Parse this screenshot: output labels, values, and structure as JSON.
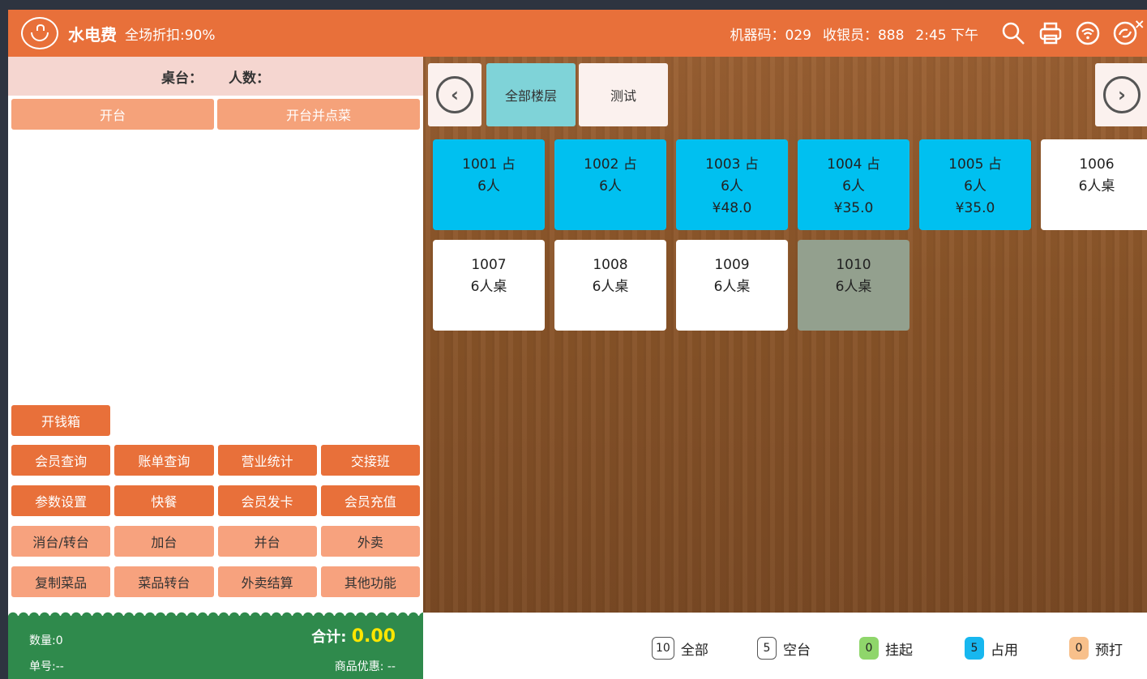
{
  "header": {
    "title": "水电费",
    "discount": "全场折扣:90%",
    "machine": "机器码：029",
    "cashier": "收银员：888",
    "time": "2:45 下午",
    "icons": [
      "search-icon",
      "printer-icon",
      "wifi-icon",
      "sync-icon"
    ]
  },
  "left": {
    "table_label": "桌台：",
    "people_label": "人数：",
    "open_table": "开台",
    "open_and_order": "开台并点菜",
    "cash_box": "开钱箱",
    "rows": [
      [
        "会员查询",
        "账单查询",
        "营业统计",
        "交接班"
      ],
      [
        "参数设置",
        "快餐",
        "会员发卡",
        "会员充值"
      ],
      [
        "消台/转台",
        "加台",
        "并台",
        "外卖"
      ],
      [
        "复制菜品",
        "菜品转台",
        "外卖结算",
        "其他功能"
      ]
    ],
    "footer": {
      "qty": "数量:0",
      "order_no": "单号:--",
      "total_label": "合计:",
      "total_value": "0.00",
      "discount": "商品优惠: --"
    }
  },
  "floors": [
    "全部楼层",
    "测试"
  ],
  "tables": [
    {
      "line1": "1001  占",
      "line2": "6人",
      "line3": "",
      "status": "busy"
    },
    {
      "line1": "1002  占",
      "line2": "6人",
      "line3": "",
      "status": "busy"
    },
    {
      "line1": "1003  占",
      "line2": "6人",
      "line3": "¥48.0",
      "status": "busy"
    },
    {
      "line1": "1004  占",
      "line2": "6人",
      "line3": "¥35.0",
      "status": "busy"
    },
    {
      "line1": "1005  占",
      "line2": "6人",
      "line3": "¥35.0",
      "status": "busy"
    },
    {
      "line1": "1006",
      "line2": "6人桌",
      "line3": "",
      "status": "free"
    },
    {
      "line1": "1007",
      "line2": "6人桌",
      "line3": "",
      "status": "free"
    },
    {
      "line1": "1008",
      "line2": "6人桌",
      "line3": "",
      "status": "free"
    },
    {
      "line1": "1009",
      "line2": "6人桌",
      "line3": "",
      "status": "free"
    },
    {
      "line1": "1010",
      "line2": "6人桌",
      "line3": "",
      "status": "gray"
    }
  ],
  "legend": [
    {
      "count": "10",
      "label": "全部",
      "color": "#ffffff"
    },
    {
      "count": "5",
      "label": "空台",
      "color": "#ffffff"
    },
    {
      "count": "0",
      "label": "挂起",
      "color": "#8fd66b"
    },
    {
      "count": "5",
      "label": "占用",
      "color": "#17b7ef"
    },
    {
      "count": "0",
      "label": "预打",
      "color": "#f8c08b"
    }
  ],
  "colors": {
    "header": "#e8703a",
    "busy": "#00c0f0",
    "footer": "#2f8a4c"
  }
}
